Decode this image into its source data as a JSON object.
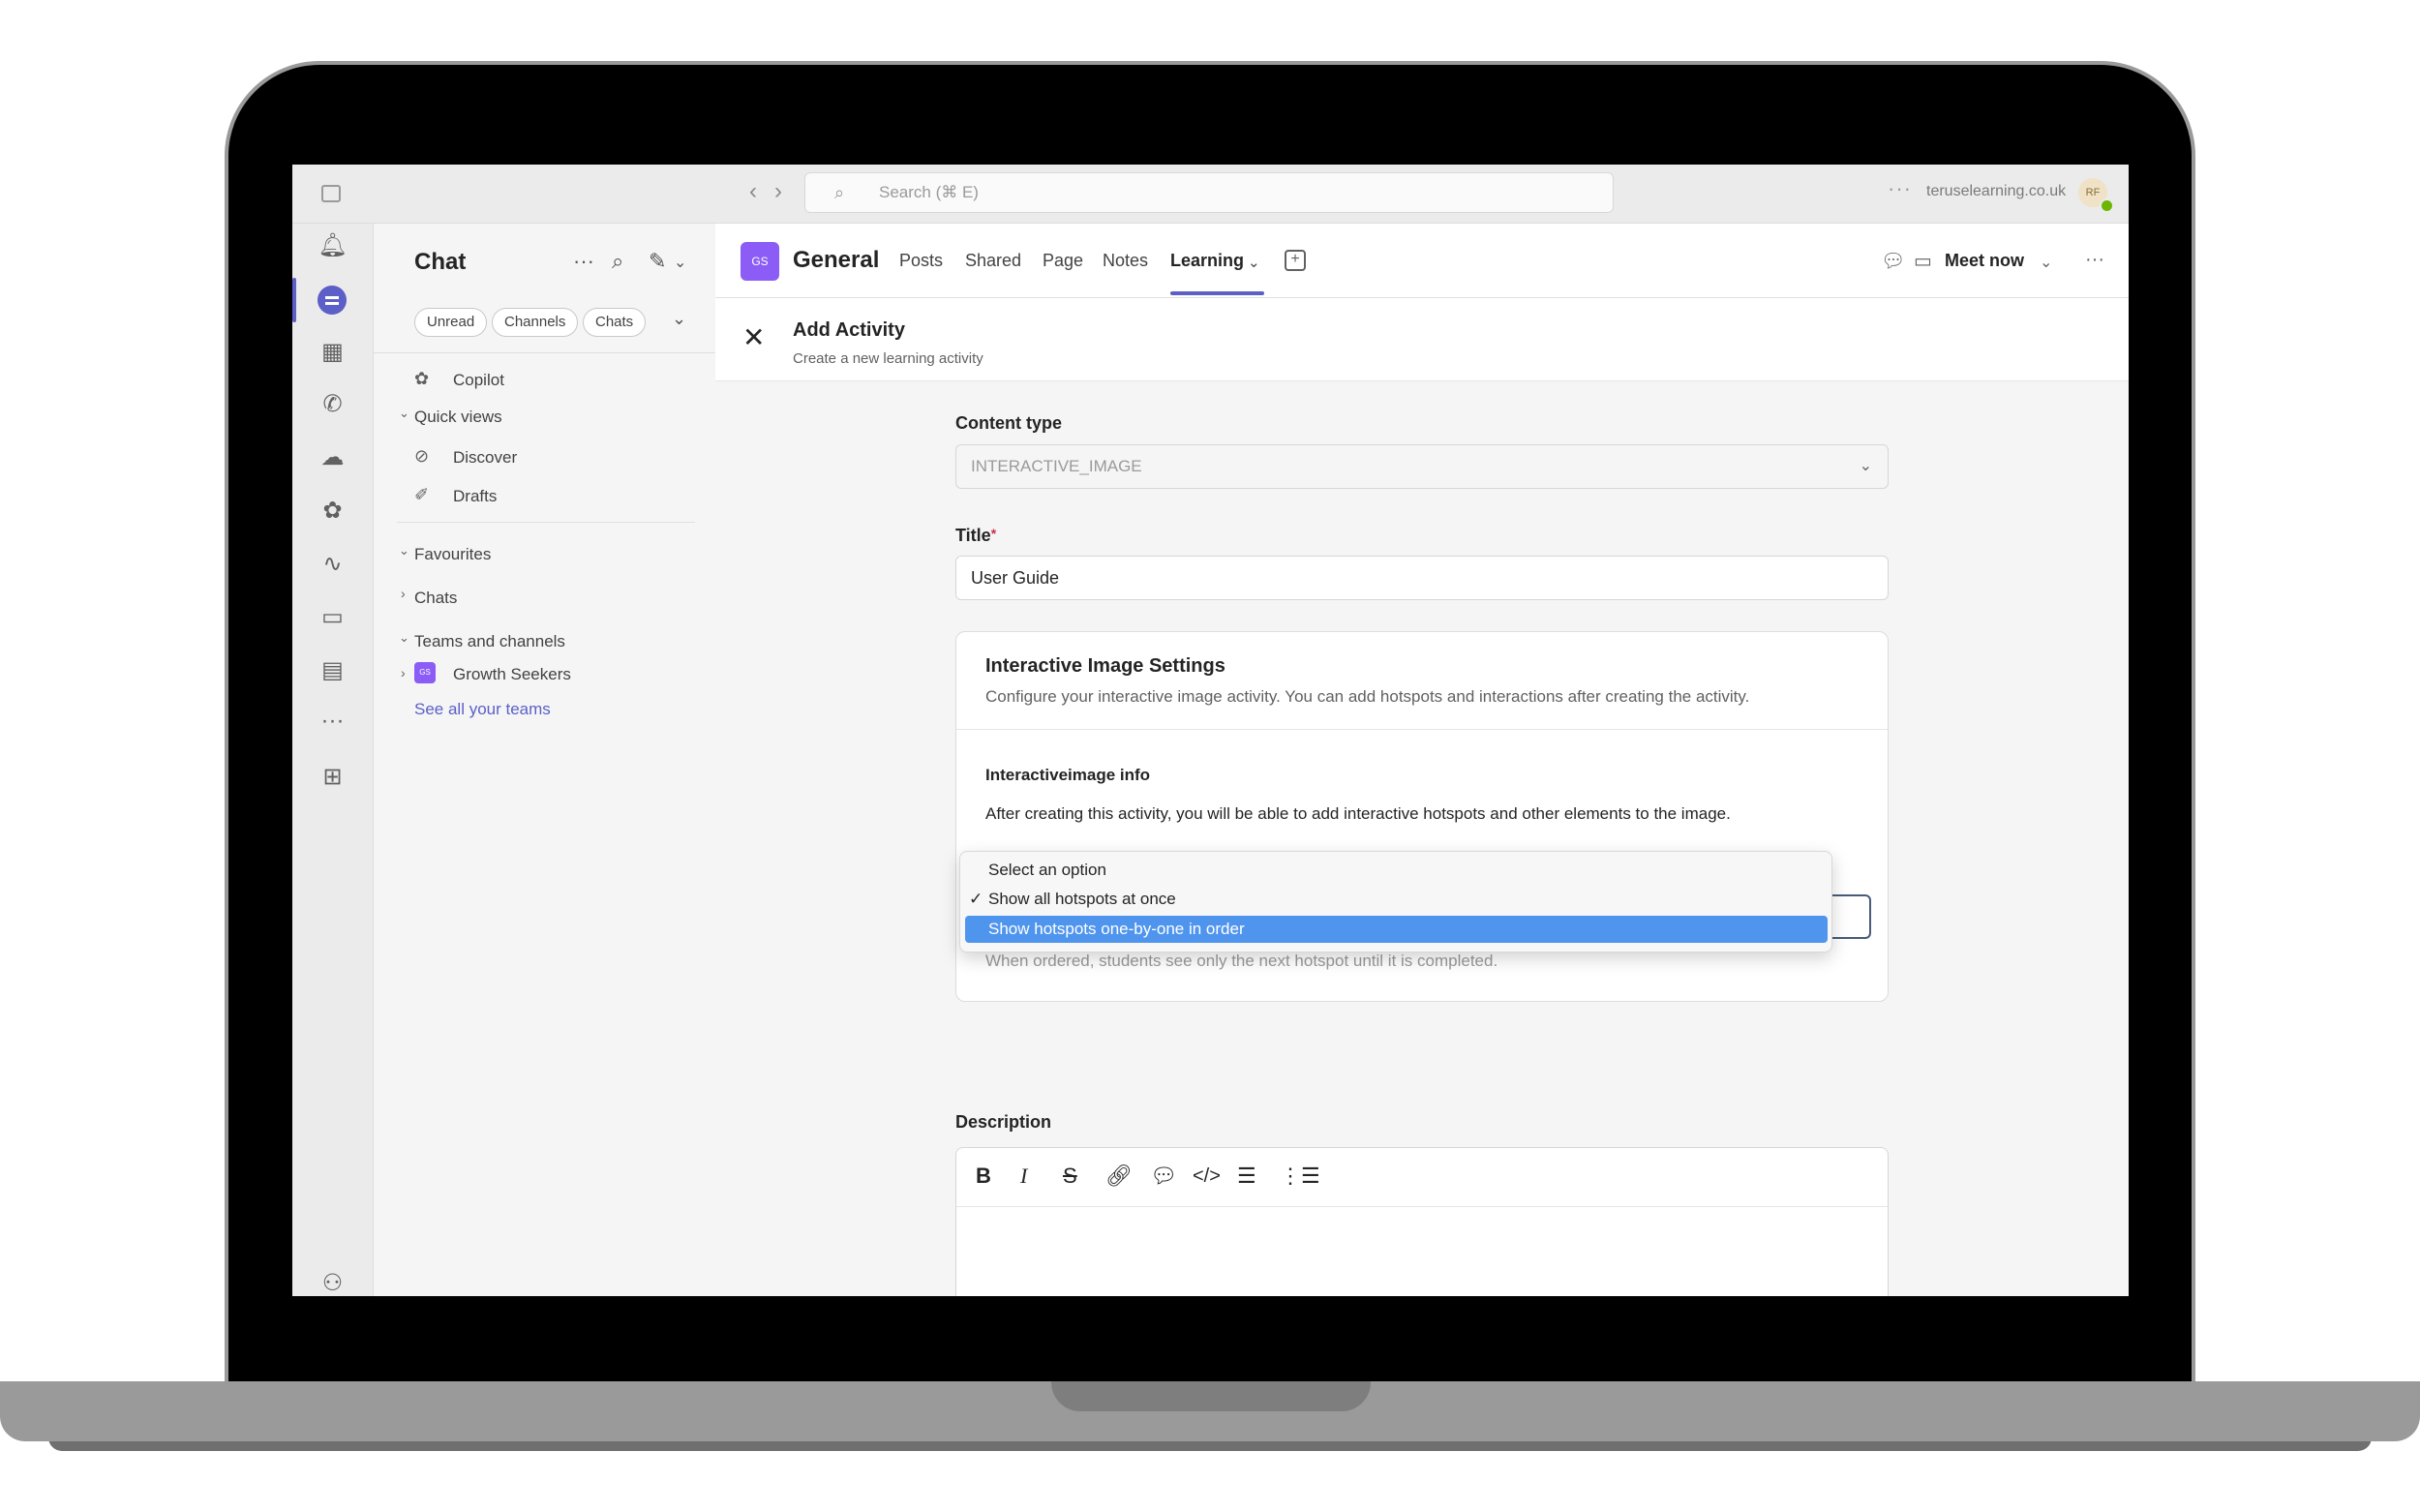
{
  "topbar": {
    "search_placeholder": "Search (⌘ E)",
    "dots": "···",
    "domain": "teruselearning.co.uk",
    "avatar_initials": "RF"
  },
  "chat_panel": {
    "title": "Chat",
    "filters": [
      "Unread",
      "Channels",
      "Chats"
    ],
    "copilot": "Copilot",
    "quick_views": "Quick views",
    "discover": "Discover",
    "drafts": "Drafts",
    "favourites": "Favourites",
    "chats": "Chats",
    "teams_and_channels": "Teams and channels",
    "team_badge": "GS",
    "team_name": "Growth Seekers",
    "see_all": "See all your teams"
  },
  "channel": {
    "avatar": "GS",
    "name": "General",
    "tabs": [
      "Posts",
      "Shared",
      "Page",
      "Notes",
      "Learning"
    ],
    "meet_now": "Meet now"
  },
  "activity": {
    "title": "Add Activity",
    "subtitle": "Create a new learning activity"
  },
  "form": {
    "content_type_label": "Content type",
    "content_type_value": "INTERACTIVE_IMAGE",
    "title_label": "Title",
    "title_required": "*",
    "title_value": "User Guide",
    "settings_title": "Interactive Image Settings",
    "settings_desc": "Configure your interactive image activity. You can add hotspots and interactions after creating the activity.",
    "info_title": "Interactiveimage info",
    "info_text": "After creating this activity, you will be able to add interactive hotspots and other elements to the image.",
    "helper_text": "When ordered, students see only the next hotspot until it is completed.",
    "description_label": "Description"
  },
  "dropdown": {
    "options": [
      "Select an option",
      "Show all hotspots at once",
      "Show hotspots one-by-one in order"
    ],
    "checked_mark": "✓",
    "checked_index": 1,
    "highlighted_index": 2
  },
  "colors": {
    "accent": "#5b5fc7",
    "team_purple": "#8b5cf6",
    "highlight_blue": "#4f95ee"
  }
}
